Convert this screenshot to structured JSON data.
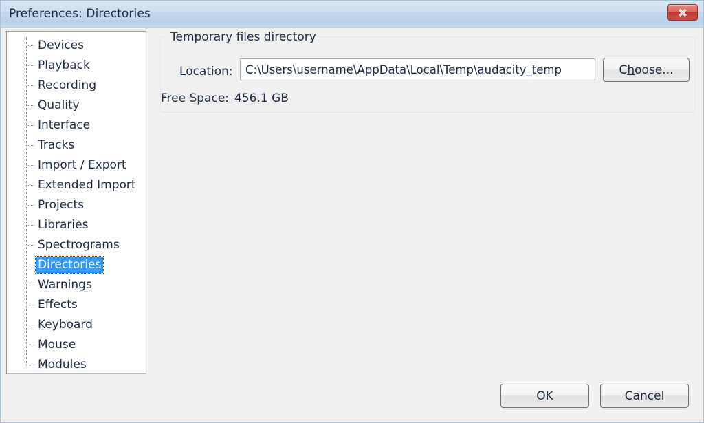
{
  "window": {
    "title": "Preferences: Directories",
    "close_icon": "close-icon",
    "accent_selection": "#3399ff",
    "close_button_color": "#c2362e",
    "body_color": "#f0f0f0"
  },
  "sidebar": {
    "items": [
      {
        "label": "Devices",
        "selected": false
      },
      {
        "label": "Playback",
        "selected": false
      },
      {
        "label": "Recording",
        "selected": false
      },
      {
        "label": "Quality",
        "selected": false
      },
      {
        "label": "Interface",
        "selected": false
      },
      {
        "label": "Tracks",
        "selected": false
      },
      {
        "label": "Import / Export",
        "selected": false
      },
      {
        "label": "Extended Import",
        "selected": false
      },
      {
        "label": "Projects",
        "selected": false
      },
      {
        "label": "Libraries",
        "selected": false
      },
      {
        "label": "Spectrograms",
        "selected": false
      },
      {
        "label": "Directories",
        "selected": true
      },
      {
        "label": "Warnings",
        "selected": false
      },
      {
        "label": "Effects",
        "selected": false
      },
      {
        "label": "Keyboard",
        "selected": false
      },
      {
        "label": "Mouse",
        "selected": false
      },
      {
        "label": "Modules",
        "selected": false
      }
    ]
  },
  "main": {
    "group_title": "Temporary files directory",
    "location_label_prefix": "",
    "location_label_accel": "L",
    "location_label_rest": "ocation:",
    "location_value": "C:\\Users\\username\\AppData\\Local\\Temp\\audacity_temp",
    "location_placeholder": "",
    "choose_prefix": "C",
    "choose_accel": "h",
    "choose_rest": "oose...",
    "free_space_label": "Free Space:",
    "free_space_value": "456.1 GB"
  },
  "footer": {
    "ok_label": "OK",
    "cancel_label": "Cancel"
  }
}
